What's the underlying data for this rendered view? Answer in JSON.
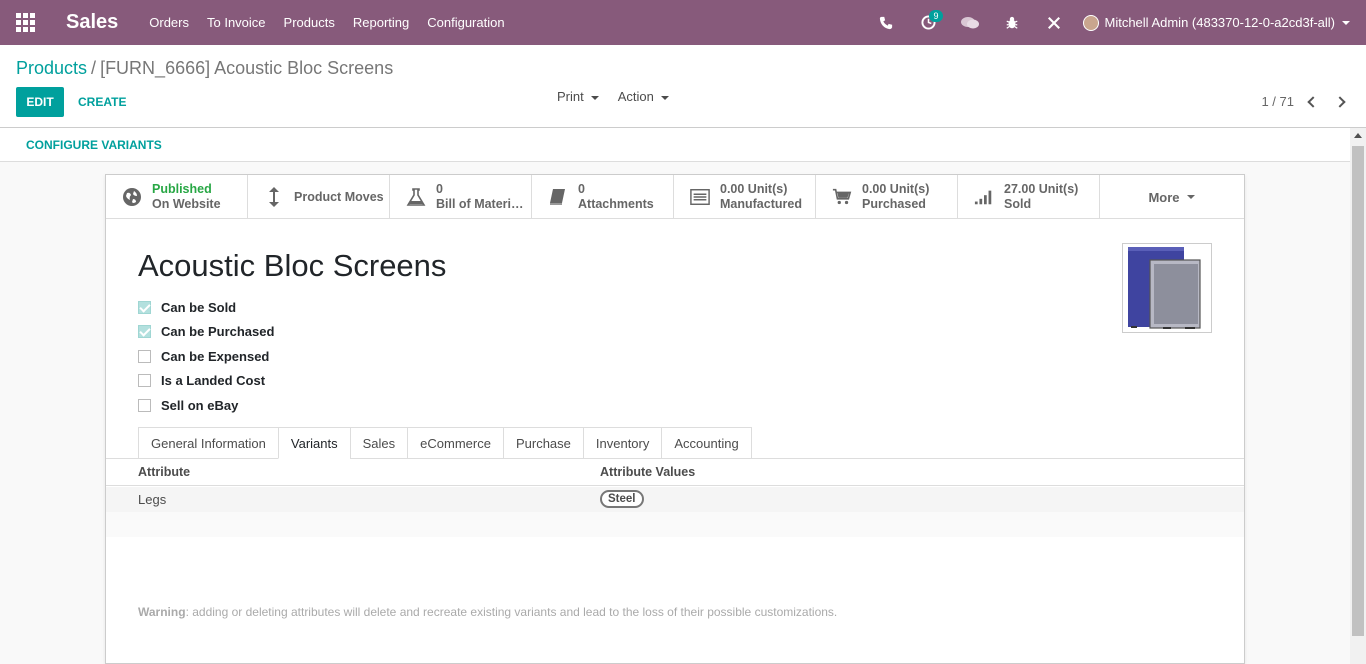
{
  "navbar": {
    "app_name": "Sales",
    "menu": [
      "Orders",
      "To Invoice",
      "Products",
      "Reporting",
      "Configuration"
    ],
    "activity_badge": "9",
    "user": "Mitchell Admin (483370-12-0-a2cd3f-all)",
    "bg_color": "#875a7b"
  },
  "breadcrumb": {
    "parent": "Products",
    "separator": "/",
    "current": "[FURN_6666] Acoustic Bloc Screens"
  },
  "toolbar": {
    "edit_label": "EDIT",
    "create_label": "CREATE",
    "print_label": "Print",
    "action_label": "Action",
    "pager": "1 / 71"
  },
  "variant_bar": {
    "configure_label": "CONFIGURE VARIANTS"
  },
  "smart_buttons": [
    {
      "line1": "Published",
      "line2": "On Website",
      "icon": "globe-icon"
    },
    {
      "line1": "Product Moves",
      "line2": "",
      "icon": "arrows-vertical-icon"
    },
    {
      "line1": "0",
      "line2": "Bill of Materi…",
      "icon": "flask-icon"
    },
    {
      "line1": "0",
      "line2": "Attachments",
      "icon": "book-icon"
    },
    {
      "line1": "0.00 Unit(s)",
      "line2": "Manufactured",
      "icon": "list-alt-icon"
    },
    {
      "line1": "0.00 Unit(s)",
      "line2": "Purchased",
      "icon": "shopping-cart-icon"
    },
    {
      "line1": "27.00 Unit(s)",
      "line2": "Sold",
      "icon": "signal-icon"
    }
  ],
  "more_label": "More",
  "product": {
    "name": "Acoustic Bloc Screens"
  },
  "checkboxes": [
    {
      "label": "Can be Sold",
      "checked": true
    },
    {
      "label": "Can be Purchased",
      "checked": true
    },
    {
      "label": "Can be Expensed",
      "checked": false
    },
    {
      "label": "Is a Landed Cost",
      "checked": false
    },
    {
      "label": "Sell on eBay",
      "checked": false
    }
  ],
  "tabs": [
    "General Information",
    "Variants",
    "Sales",
    "eCommerce",
    "Purchase",
    "Inventory",
    "Accounting"
  ],
  "active_tab": "Variants",
  "attributes": {
    "header_attribute": "Attribute",
    "header_values": "Attribute Values",
    "rows": [
      {
        "attribute": "Legs",
        "values": [
          "Steel"
        ]
      }
    ]
  },
  "warning": {
    "label": "Warning",
    "text": ": adding or deleting attributes will delete and recreate existing variants and lead to the loss of their possible customizations."
  },
  "accent_color": "#00a09d"
}
